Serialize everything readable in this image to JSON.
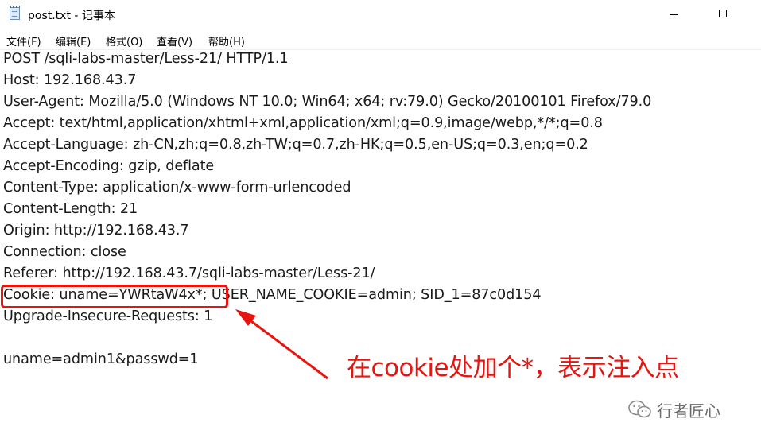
{
  "window": {
    "title": "post.txt - 记事本"
  },
  "menu": [
    "文件(F)",
    "编辑(E)",
    "格式(O)",
    "查看(V)",
    "帮助(H)"
  ],
  "content_lines": [
    "POST /sqli-labs-master/Less-21/ HTTP/1.1",
    "Host: 192.168.43.7",
    "User-Agent: Mozilla/5.0 (Windows NT 10.0; Win64; x64; rv:79.0) Gecko/20100101 Firefox/79.0",
    "Accept: text/html,application/xhtml+xml,application/xml;q=0.9,image/webp,*/*;q=0.8",
    "Accept-Language: zh-CN,zh;q=0.8,zh-TW;q=0.7,zh-HK;q=0.5,en-US;q=0.3,en;q=0.2",
    "Accept-Encoding: gzip, deflate",
    "Content-Type: application/x-www-form-urlencoded",
    "Content-Length: 21",
    "Origin: http://192.168.43.7",
    "Connection: close",
    "Referer: http://192.168.43.7/sqli-labs-master/Less-21/",
    "Cookie: uname=YWRtaW4x*; USER_NAME_COOKIE=admin; SID_1=87c0d154",
    "Upgrade-Insecure-Requests: 1",
    "",
    "uname=admin1&passwd=1"
  ],
  "annotation": {
    "text": "在cookie处加个*，表示注入点",
    "color": "#e8140f"
  },
  "watermark": {
    "text": "行者匠心",
    "icon": "wechat-icon"
  }
}
